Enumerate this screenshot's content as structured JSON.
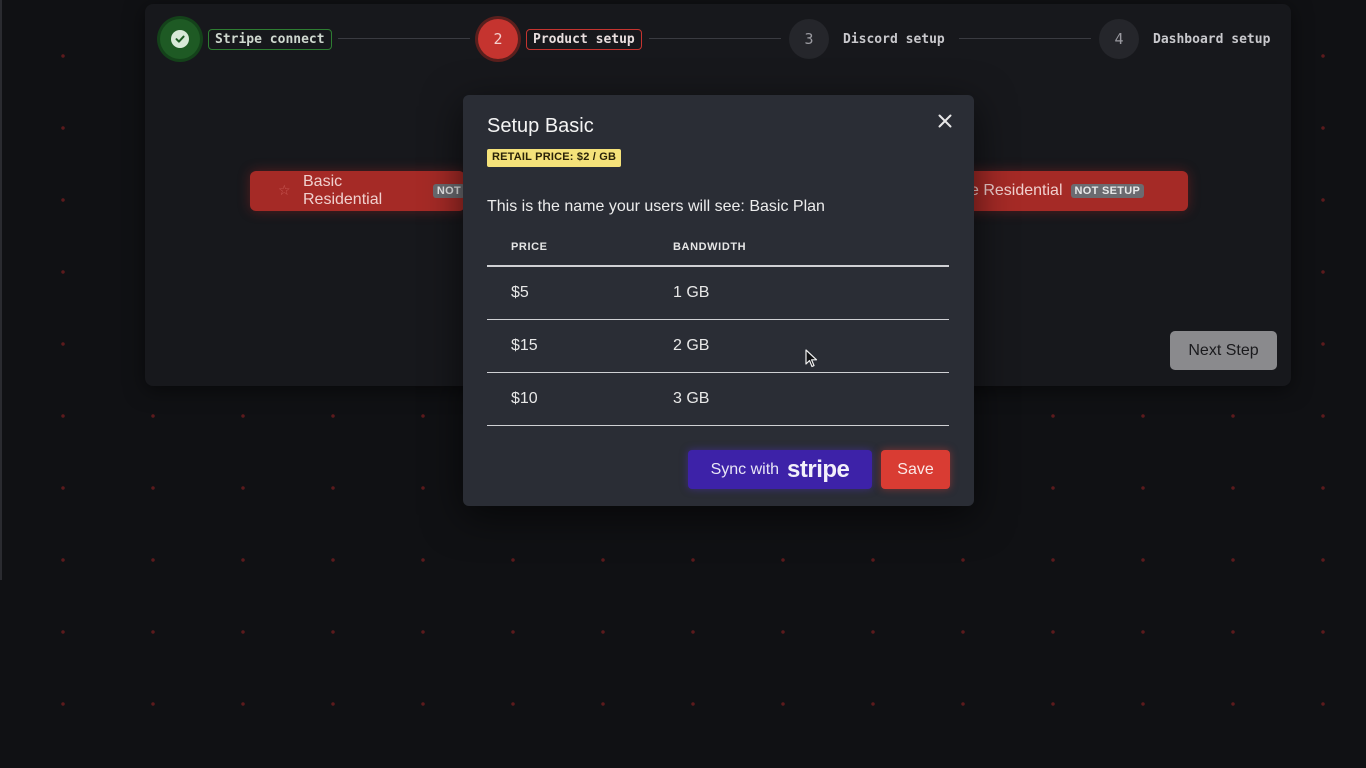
{
  "stepper": {
    "steps": [
      {
        "number": "",
        "label": "Stripe connect",
        "state": "done"
      },
      {
        "number": "2",
        "label": "Product setup",
        "state": "active"
      },
      {
        "number": "3",
        "label": "Discord setup",
        "state": "pending"
      },
      {
        "number": "4",
        "label": "Dashboard setup",
        "state": "pending"
      }
    ]
  },
  "products": {
    "left_label": "Basic Residential",
    "left_badge": "NOT",
    "right_label": "e Residential",
    "right_badge": "NOT SETUP"
  },
  "next_step_label": "Next Step",
  "modal": {
    "title": "Setup Basic",
    "retail_badge": "RETAIL PRICE: $2 / GB",
    "description": "This is the name your users will see: Basic Plan",
    "table": {
      "headers": [
        "PRICE",
        "BANDWIDTH"
      ],
      "rows": [
        [
          "$5",
          "1 GB"
        ],
        [
          "$15",
          "2 GB"
        ],
        [
          "$10",
          "3 GB"
        ]
      ]
    },
    "sync_prefix": "Sync with",
    "sync_brand": "stripe",
    "save_label": "Save"
  },
  "colors": {
    "accent_red": "#c5342f",
    "stripe_purple": "#3d22a8",
    "success_green": "#1e5a24",
    "retail_badge_yellow": "#f5e27a"
  }
}
